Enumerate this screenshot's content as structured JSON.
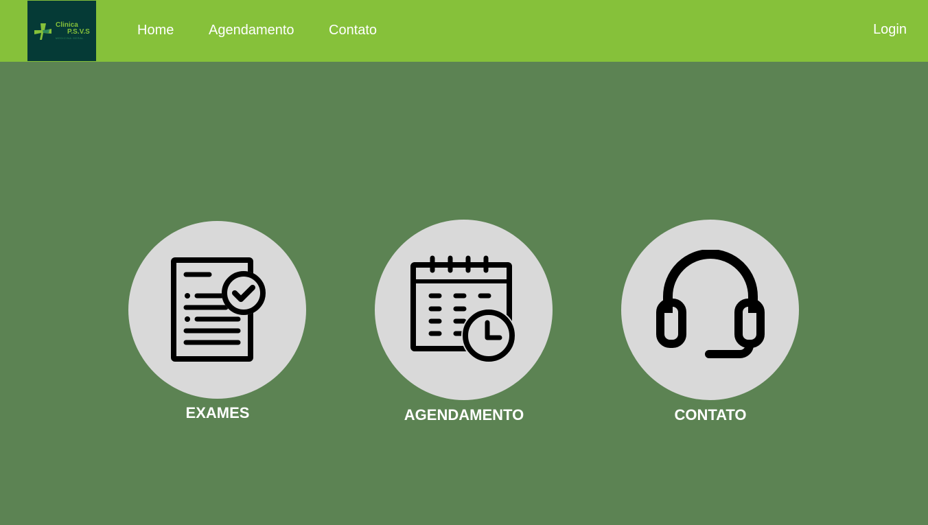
{
  "brand": {
    "line1": "Clinica",
    "line2": "P.S.V.S",
    "tagline": "MEDICINA GERAL",
    "colors": {
      "navbar": "#86c13a",
      "logo_bg": "#053a36",
      "page_bg": "#5c8353",
      "circle": "#d9d9d9"
    }
  },
  "nav": {
    "home": "Home",
    "agendamento": "Agendamento",
    "contato": "Contato",
    "login": "Login"
  },
  "cards": [
    {
      "label": "EXAMES",
      "icon": "document-check-icon"
    },
    {
      "label": "AGENDAMENTO",
      "icon": "calendar-clock-icon"
    },
    {
      "label": "CONTATO",
      "icon": "headset-icon"
    }
  ]
}
